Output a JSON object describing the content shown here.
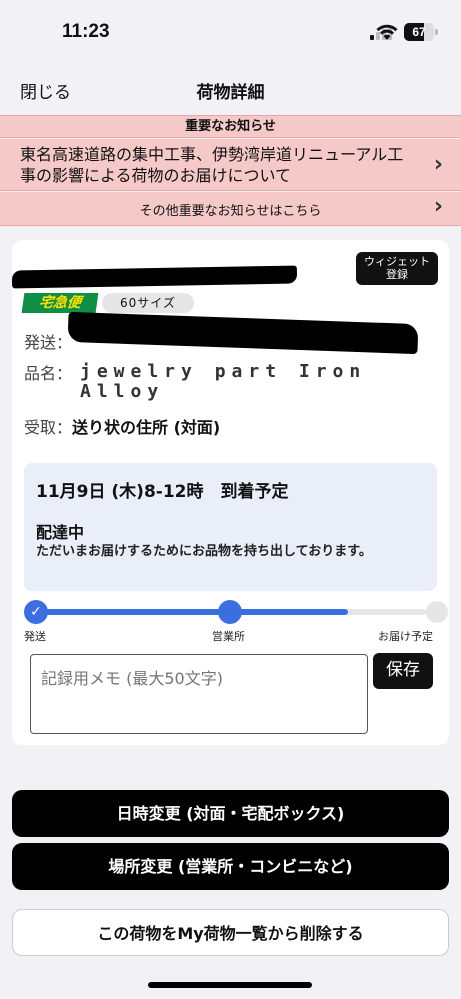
{
  "status_bar": {
    "time": "11:23",
    "battery_level": "67",
    "battery_fraction": 0.67
  },
  "nav": {
    "close_label": "閉じる",
    "title": "荷物詳細"
  },
  "notice": {
    "heading": "重要なお知らせ",
    "main_text": "東名高速道路の集中工事、伊勢湾岸道リニューアル工事の影響による荷物のお届けについて",
    "more_text": "その他重要なお知らせはこちら"
  },
  "package": {
    "widget_label_line1": "ウィジェット",
    "widget_label_line2": "登録",
    "service_name": "宅急便",
    "size": "60サイズ",
    "sender_label": "発送：",
    "item_label": "品名：",
    "item_value": "jewelry part Iron Alloy",
    "receive_label": "受取：",
    "receive_value": "送り状の住所 (対面)"
  },
  "delivery": {
    "eta": "11月9日 (木)8-12時　到着予定",
    "status": "配達中",
    "status_desc": "ただいまお届けするためにお品物を持ち出しております。"
  },
  "progress": {
    "fraction": 0.8,
    "steps": [
      "発送",
      "営業所",
      "お届け予定"
    ]
  },
  "memo": {
    "placeholder": "記録用メモ (最大50文字)",
    "save_label": "保存"
  },
  "actions": {
    "change_datetime": "日時変更 (対面・宅配ボックス)",
    "change_location": "場所変更 (営業所・コンビニなど)",
    "remove": "この荷物をMy荷物一覧から削除する"
  }
}
